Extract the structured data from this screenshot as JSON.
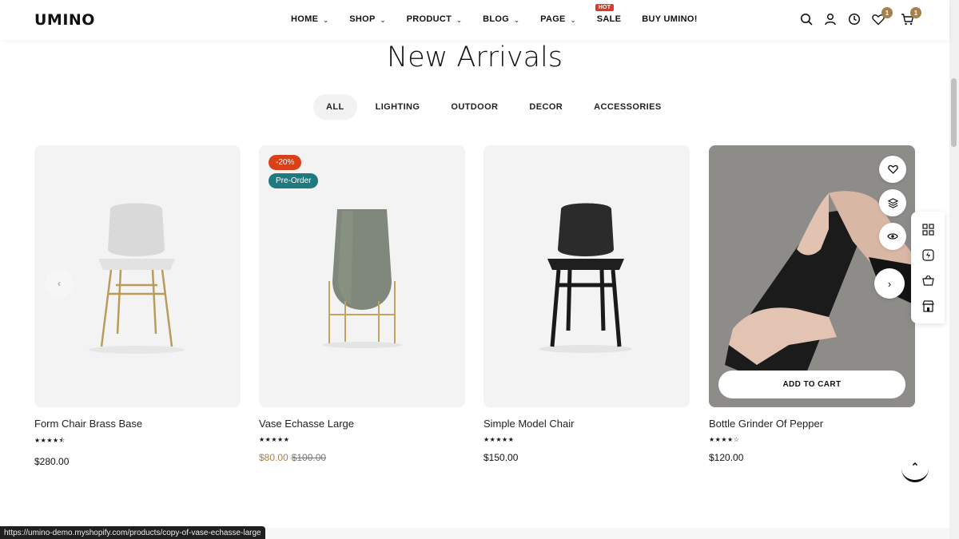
{
  "header": {
    "logo": "UMINO",
    "nav": [
      {
        "label": "HOME",
        "has_dropdown": true
      },
      {
        "label": "SHOP",
        "has_dropdown": true
      },
      {
        "label": "PRODUCT",
        "has_dropdown": true
      },
      {
        "label": "BLOG",
        "has_dropdown": true
      },
      {
        "label": "PAGE",
        "has_dropdown": true
      },
      {
        "label": "SALE",
        "has_dropdown": false,
        "badge": "HOT"
      },
      {
        "label": "BUY UMINO!",
        "has_dropdown": false
      }
    ],
    "icons": [
      "search-icon",
      "user-icon",
      "clock-icon",
      "heart-icon",
      "cart-icon"
    ],
    "wishlist_count": "1",
    "cart_count": "1"
  },
  "section": {
    "title": "New Arrivals",
    "tabs": [
      "ALL",
      "LIGHTING",
      "OUTDOOR",
      "DECOR",
      "ACCESSORIES"
    ],
    "active_tab": "ALL"
  },
  "products": [
    {
      "name": "Form Chair Brass Base",
      "stars": "★★★★⯪",
      "price": "$280.00"
    },
    {
      "name": "Vase Echasse Large",
      "stars": "★★★★★",
      "price": "$80.00",
      "old_price": "$100.00",
      "discount_badge": "-20%",
      "preorder_badge": "Pre-Order"
    },
    {
      "name": "Simple Model Chair",
      "stars": "★★★★★",
      "price": "$150.00"
    },
    {
      "name": "Bottle Grinder Of Pepper",
      "stars": "★★★★☆",
      "price": "$120.00",
      "add_to_cart": "ADD TO CART"
    }
  ],
  "status_url": "https://umino-demo.myshopify.com/products/copy-of-vase-echasse-large",
  "colors": {
    "accent": "#a8814a",
    "sale_red": "#d94118",
    "preorder_teal": "#1f7a80",
    "hot_red": "#d93a2b"
  }
}
